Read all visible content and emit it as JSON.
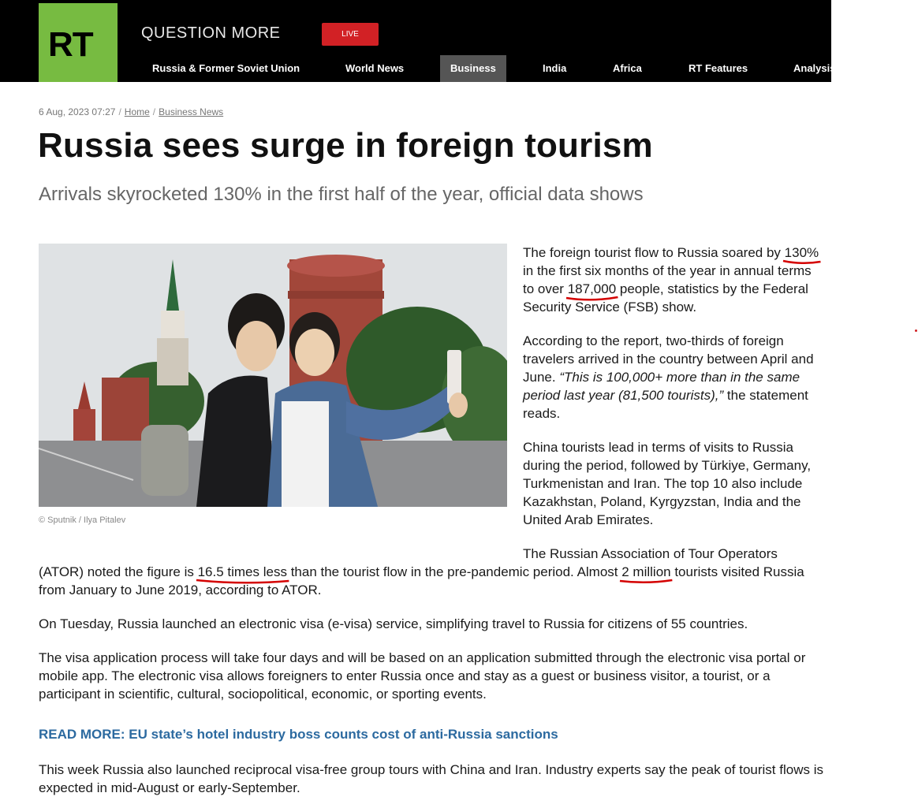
{
  "header": {
    "logo": "RT",
    "slogan": "QUESTION MORE",
    "live_label": "LIVE",
    "nav": [
      {
        "label": "Russia & Former Soviet Union",
        "active": false
      },
      {
        "label": "World News",
        "active": false
      },
      {
        "label": "Business",
        "active": true
      },
      {
        "label": "India",
        "active": false
      },
      {
        "label": "Africa",
        "active": false
      },
      {
        "label": "RT Features",
        "active": false
      },
      {
        "label": "Analysis",
        "active": false
      }
    ]
  },
  "breadcrumb": {
    "date": "6 Aug, 2023 07:27",
    "home": "Home",
    "section": "Business News"
  },
  "article": {
    "title": "Russia sees surge in foreign tourism",
    "subtitle": "Arrivals skyrocketed 130% in the first half of the year, official data shows",
    "photo_caption": "© Sputnik / Ilya Pitalev",
    "p1": {
      "a": "The foreign tourist flow to Russia soared by ",
      "u1": "130% ",
      "b": "in the first six months of the year in annual terms to over ",
      "u2": "187,000",
      "c": " people, statistics by the Federal Security Service (FSB) show."
    },
    "p2": {
      "a": "According to the report, two-thirds of foreign travelers arrived in the country between April and June. ",
      "quote": "“This is 100,000+ more than in the same period last year (81,500 tourists),”",
      "b": " the statement reads."
    },
    "p3": "China tourists lead in terms of visits to Russia during the period, followed by Türkiye, Germany, Turkmenistan and Iran. The top 10 also include Kazakhstan, Poland, Kyrgyzstan, India and the United Arab Emirates.",
    "p4": {
      "line1": "The Russian Association of Tour Operators",
      "a": "(ATOR) noted the figure is ",
      "u1": "16.5 times less",
      "b": " than the tourist flow in the pre-pandemic period. Almost ",
      "u2": "2 million",
      "c": " tourists visited Russia from January to June 2019, according to ATOR."
    },
    "p5": "On Tuesday, Russia launched an electronic visa (e-visa) service, simplifying travel to Russia for citizens of 55 countries.",
    "p6": "The visa application process will take four days and will be based on an application submitted through the electronic visa portal or mobile app. The electronic visa allows foreigners to enter Russia once and stay as a guest or business visitor, a tourist, or a participant in scientific, cultural, sociopolitical, economic, or sporting events.",
    "read_more": {
      "label": "READ MORE",
      "colon": ": ",
      "title": "EU state’s hotel industry boss counts cost of anti-Russia sanctions"
    },
    "p7": "This week Russia also launched reciprocal visa-free group tours with China and Iran. Industry experts say the peak of tourist flows is expected in mid-August or early-September."
  },
  "colors": {
    "brand_green": "#77bb41",
    "live_red": "#d22125",
    "link_blue": "#2c6aa0",
    "underline_red": "#d40000"
  }
}
